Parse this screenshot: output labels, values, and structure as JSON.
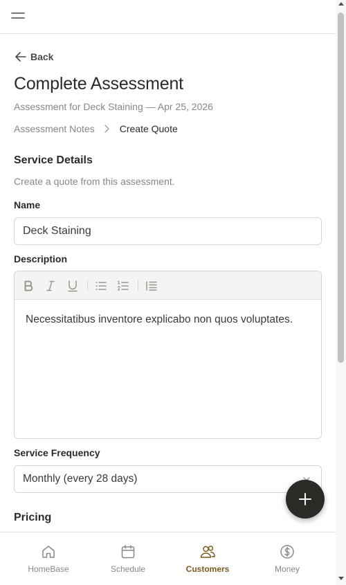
{
  "header": {
    "menu_icon": "hamburger-icon"
  },
  "nav": {
    "back_label": "Back"
  },
  "page": {
    "title": "Complete Assessment",
    "subtitle": "Assessment for Deck Staining — Apr 25, 2026",
    "breadcrumbs": [
      "Assessment Notes",
      "Create Quote"
    ]
  },
  "form": {
    "section_title": "Service Details",
    "section_description": "Create a quote from this assessment.",
    "name_label": "Name",
    "name_value": "Deck Staining",
    "description_label": "Description",
    "description_value": "Necessitatibus inventore explicabo non quos voluptates.",
    "toolbar_icons": [
      "bold-icon",
      "italic-icon",
      "underline-icon",
      "bullet-list-icon",
      "numbered-list-icon",
      "indent-icon"
    ],
    "frequency_label": "Service Frequency",
    "frequency_value": "Monthly (every 28 days)",
    "pricing_title": "Pricing"
  },
  "fab": {
    "icon": "plus-icon"
  },
  "bottom_nav": {
    "items": [
      {
        "label": "HomeBase",
        "icon": "home-icon"
      },
      {
        "label": "Schedule",
        "icon": "calendar-icon"
      },
      {
        "label": "Customers",
        "icon": "users-icon",
        "active": true
      },
      {
        "label": "Money",
        "icon": "dollar-icon"
      }
    ]
  },
  "colors": {
    "accent": "#7a5a1e",
    "text": "#2b2a27",
    "muted": "#8a8781",
    "fab": "#2b2a27"
  }
}
